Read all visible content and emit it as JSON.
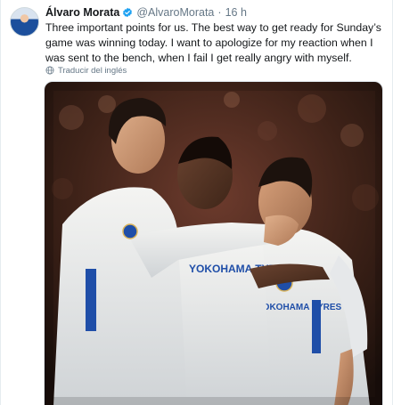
{
  "tweet": {
    "author_name": "Álvaro Morata",
    "handle": "@AlvaroMorata",
    "separator": "·",
    "time": "16 h",
    "text": "Three important points for us. The best way to get ready for Sunday’s game was winning today. I want to apologize for my reaction when I was sent to the bench, when I fail I get really angry with myself.",
    "translate_label": "Traducir del inglés",
    "verified_icon": "verified-badge-icon",
    "translate_icon": "globe-icon",
    "accent_color": "#1da1f2"
  },
  "media": {
    "kit_sponsor_left": "YOKOHAMA TYRES",
    "kit_sponsor_right": "YOKOHAMA TYRES",
    "kit_sponsor_partial": "OHAMA"
  }
}
